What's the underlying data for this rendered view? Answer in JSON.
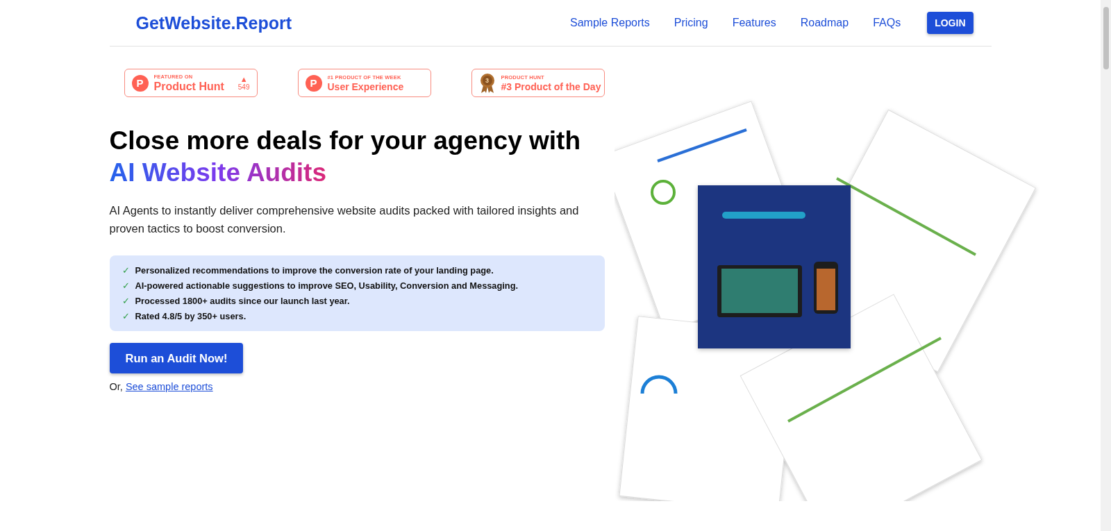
{
  "header": {
    "logo": "GetWebsite.Report",
    "nav": [
      {
        "label": "Sample Reports",
        "kind": "link"
      },
      {
        "label": "Pricing",
        "kind": "link"
      },
      {
        "label": "Features",
        "kind": "link"
      },
      {
        "label": "Roadmap",
        "kind": "link"
      },
      {
        "label": "FAQs",
        "kind": "link"
      },
      {
        "label": "LOGIN",
        "kind": "button"
      }
    ]
  },
  "badges": [
    {
      "kind": "letter",
      "icon_text": "P",
      "caption": "FEATURED ON",
      "title": "Product Hunt",
      "upvote": {
        "arrow": "▲",
        "count": "549"
      }
    },
    {
      "kind": "letter",
      "icon_text": "P",
      "caption": "#1 PRODUCT OF THE WEEK",
      "title": "User Experience"
    },
    {
      "kind": "medal",
      "icon_text": "3",
      "caption": "PRODUCT HUNT",
      "title": "#3 Product of the Day"
    }
  ],
  "hero": {
    "headline": "Close more deals for your agency with ",
    "headline_highlight": "AI Website Audits",
    "description": "AI Agents to instantly deliver comprehensive website audits packed with tailored insights and proven tactics to boost conversion.",
    "features": [
      {
        "mark": "✓",
        "text": "Personalized recommendations to improve the conversion rate of your landing page."
      },
      {
        "mark": "✓",
        "text": "AI-powered actionable suggestions to improve SEO, Usability, Conversion and Messaging."
      },
      {
        "mark": "✓",
        "text": "Processed 1800+ audits since our launch last year."
      },
      {
        "mark": "✓",
        "text": "Rated 4.8/5 by 350+ users."
      }
    ],
    "cta": "Run an Audit Now!",
    "alt_prefix": "Or, ",
    "alt_link": "See sample reports"
  }
}
